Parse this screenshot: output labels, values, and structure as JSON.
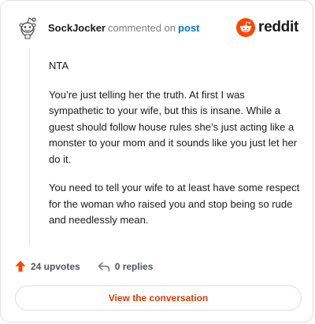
{
  "header": {
    "username": "SockJocker",
    "action_text": "commented on",
    "target_link": "post",
    "brand": "reddit",
    "brand_color": "#ff4500"
  },
  "comment": {
    "paragraphs": [
      "NTA",
      "You’re just telling her the truth. At first I was sympathetic to your wife, but this is insane. While a guest should follow house rules she’s just acting like a monster to your mom and it sounds like you just let her do it.",
      "You need to tell your wife to at least have some respect for the woman who raised you and stop being so rude and needlessly mean."
    ]
  },
  "actions": {
    "upvotes_label": "24 upvotes",
    "replies_label": "0 replies",
    "upvote_icon": "upvote-arrow-icon",
    "reply_icon": "reply-arrow-icon"
  },
  "cta": {
    "label": "View the conversation",
    "color": "#d93a00"
  }
}
